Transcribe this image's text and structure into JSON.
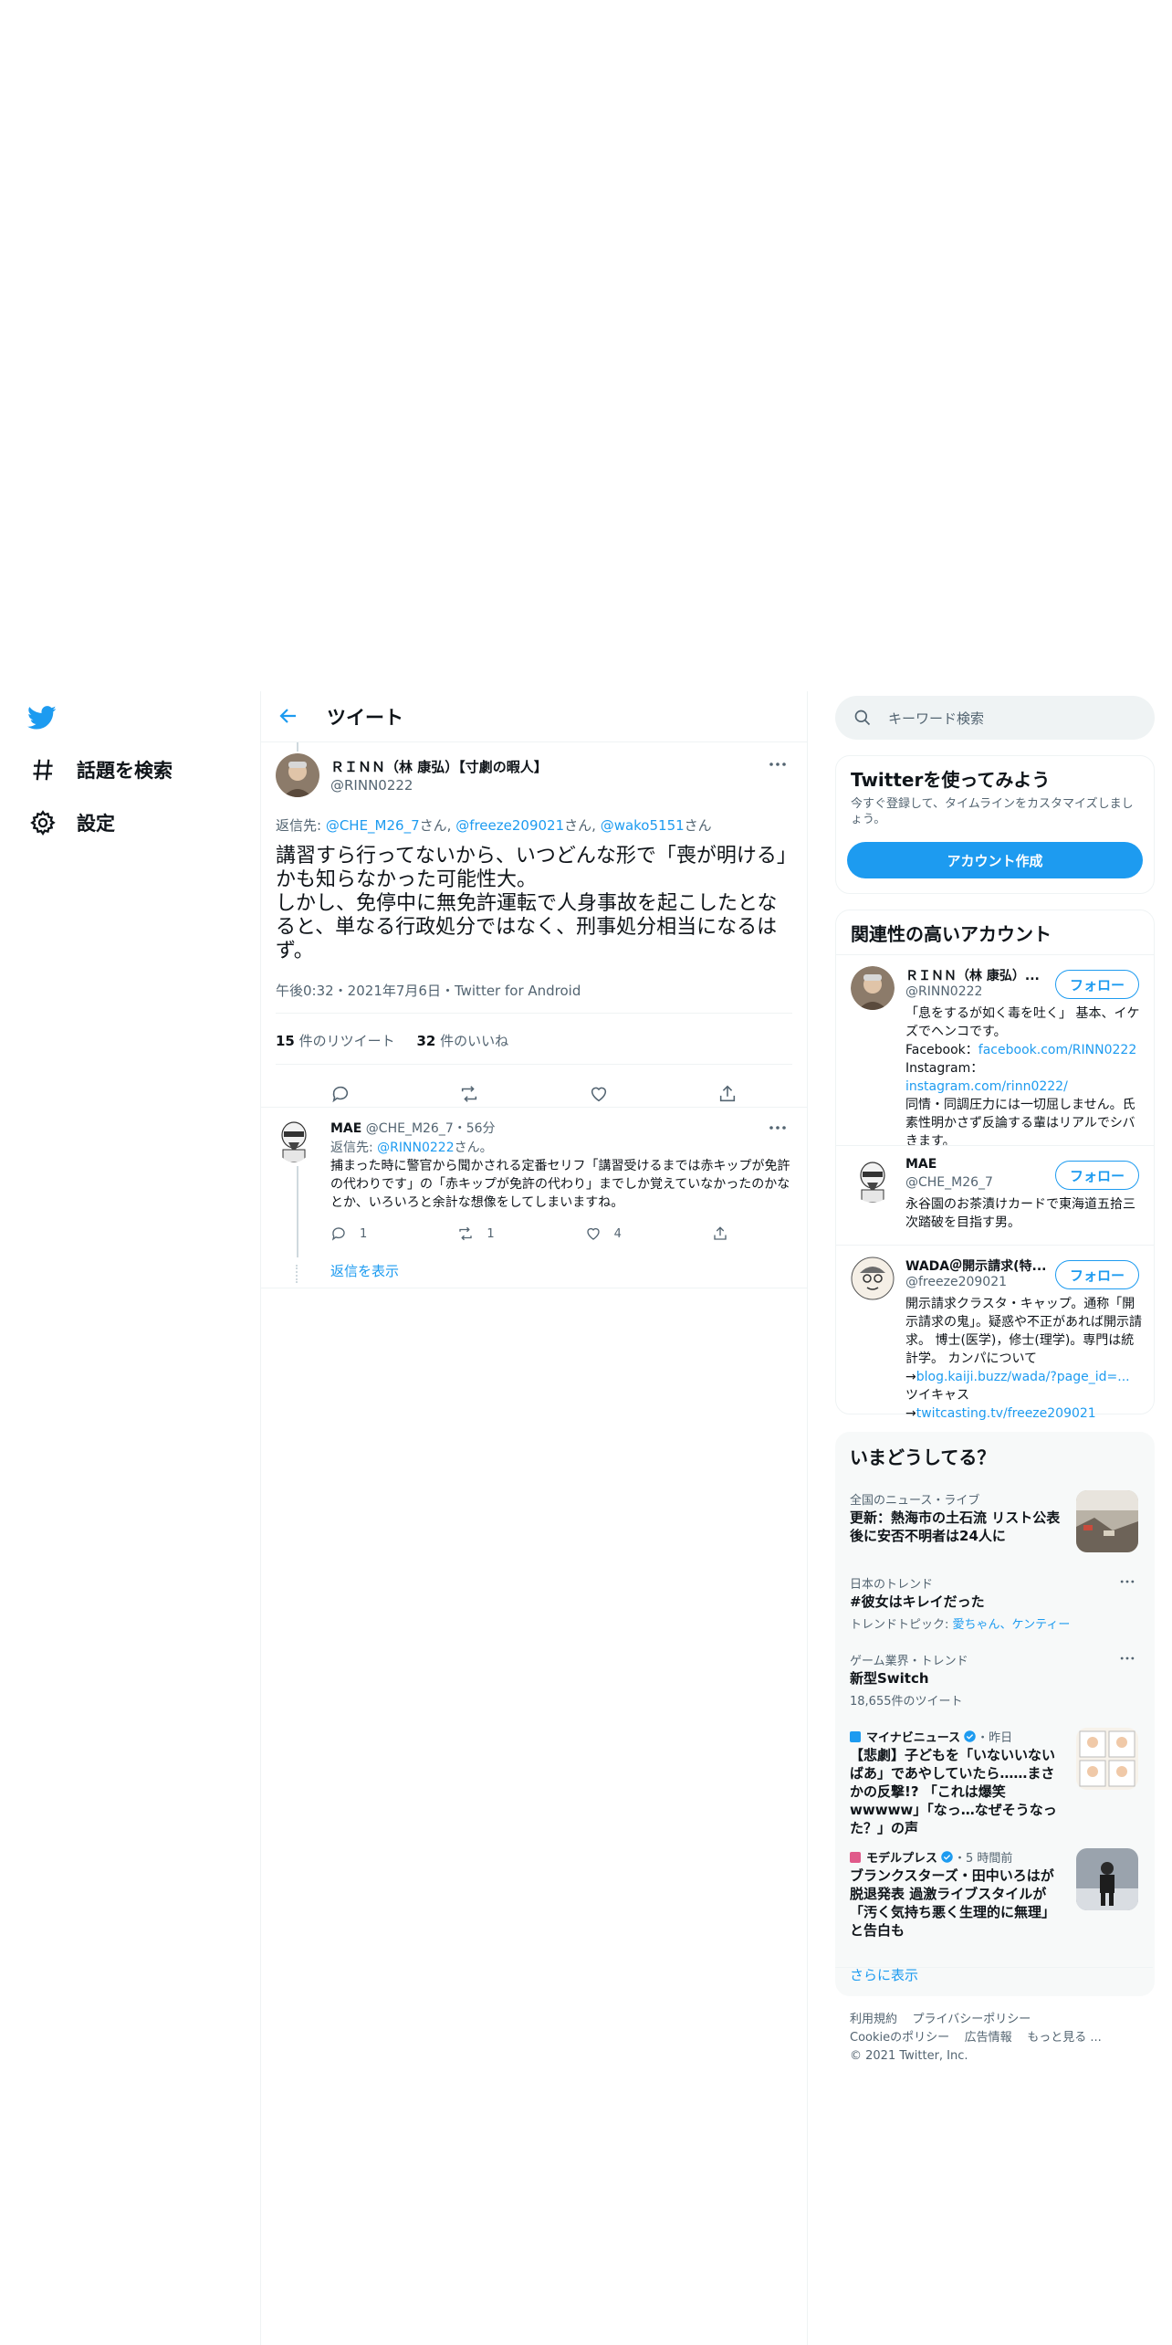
{
  "nav": {
    "explore": "話題を検索",
    "settings": "設定"
  },
  "header": {
    "title": "ツイート"
  },
  "main_tweet": {
    "display_name": "ＲＩＮＮ（林 康弘）【寸劇の暇人】",
    "handle": "@RINN0222",
    "reply_prefix": "返信先: ",
    "reply_to_1": "@CHE_M26_7",
    "reply_sep_1": "さん, ",
    "reply_to_2": "@freeze209021",
    "reply_sep_2": "さん, ",
    "reply_to_3": "@wako5151",
    "reply_suffix": "さん",
    "text_line1": "講習すら行ってないから、いつどんな形で「喪が明ける」かも知らなかった可能性大。",
    "text_line2": "しかし、免停中に無免許運転で人身事故を起こしたとなると、単なる行政処分ではなく、刑事処分相当になるはず。",
    "meta": "午後0:32・2021年7月6日・Twitter for Android",
    "retweet_count": "15",
    "retweet_label": " 件のリツイート",
    "like_count": "32",
    "like_label": " 件のいいね"
  },
  "reply_tweet": {
    "display_name": "MAE",
    "handle_time": "@CHE_M26_7・56分",
    "reply_prefix": "返信先: ",
    "reply_to": "@RINN0222",
    "reply_suffix": "さん。",
    "text": "捕まった時に警官から聞かされる定番セリフ「講習受けるまでは赤キップが免許の代わりです」の「赤キップが免許の代わり」までしか覚えていなかったのかなとか、いろいろと余計な想像をしてしまいますね。",
    "reply_count": "1",
    "retweet_count": "1",
    "like_count": "4",
    "show_replies": "返信を表示"
  },
  "search": {
    "placeholder": "キーワード検索"
  },
  "signup": {
    "title": "Twitterを使ってみよう",
    "desc": "今すぐ登録して、タイムラインをカスタマイズしましょう。",
    "button": "アカウント作成"
  },
  "related": {
    "title": "関連性の高いアカウント",
    "follow_label": "フォロー",
    "accounts": [
      {
        "name": "ＲＩＮＮ（林 康弘）...",
        "handle": "@RINN0222",
        "bio_1": "「息をするが如く毒を吐く」 基本、イケズでヘンコです。",
        "bio_fb_label": "Facebook：",
        "bio_fb_link": "facebook.com/RINN0222",
        "bio_ig_label": "Instagram：",
        "bio_ig_link": "instagram.com/rinn0222/",
        "bio_2": "同情・同調圧力には一切屈しません。氏素性明かさず反論する輩はリアルでシバきます。"
      },
      {
        "name": "MAE",
        "handle": "@CHE_M26_7",
        "bio_1": "永谷園のお茶漬けカードで東海道五拾三次踏破を目指す男。"
      },
      {
        "name": "WADA＠開示請求(特...",
        "handle": "@freeze209021",
        "bio_1": "開示請求クラスタ・キャップ。通称「開示請求の鬼」。疑惑や不正があれば開示請求。 博士(医学)，修士(理学)。専門は統計学。 カンパについて→",
        "bio_link_1": "blog.kaiji.buzz/wada/?page_id=...",
        "bio_mid": " ツイキャス→",
        "bio_link_2": "twitcasting.tv/freeze209021"
      }
    ]
  },
  "trends": {
    "title": "いまどうしてる？",
    "items": [
      {
        "context": "全国のニュース・ライブ",
        "name": "更新：熱海市の土石流 リスト公表後に安否不明者は24人に"
      },
      {
        "context": "日本のトレンド",
        "name": "#彼女はキレイだった",
        "sub_prefix": "トレンドトピック: ",
        "sub_links": "愛ちゃん、ケンティー"
      },
      {
        "context": "ゲーム業界・トレンド",
        "name": "新型Switch",
        "sub": "18,655件のツイート"
      },
      {
        "source": "マイナビニュース",
        "time": "・昨日",
        "name": "【悲劇】子どもを「いないいないばあ」であやしていたら……まさかの反撃!? 「これは爆笑wwwww」「なっ…なぜそうなった？」の声"
      },
      {
        "source": "モデルプレス",
        "time": "・5 時間前",
        "name": "ブランクスターズ・田中いろはが脱退発表 過激ライブスタイルが「汚く気持ち悪く生理的に無理」と告白も"
      }
    ],
    "show_more": "さらに表示"
  },
  "footer": {
    "terms": "利用規約",
    "privacy": "プライバシーポリシー",
    "cookie": "Cookieのポリシー",
    "ads": "広告情報",
    "more": "もっと見る ...",
    "copyright": "© 2021 Twitter, Inc."
  },
  "colors": {
    "accent": "#1d9bf0",
    "text": "#0f1419",
    "muted": "#536471",
    "border": "#eff3f4",
    "card_bg": "#f7f9f9"
  }
}
